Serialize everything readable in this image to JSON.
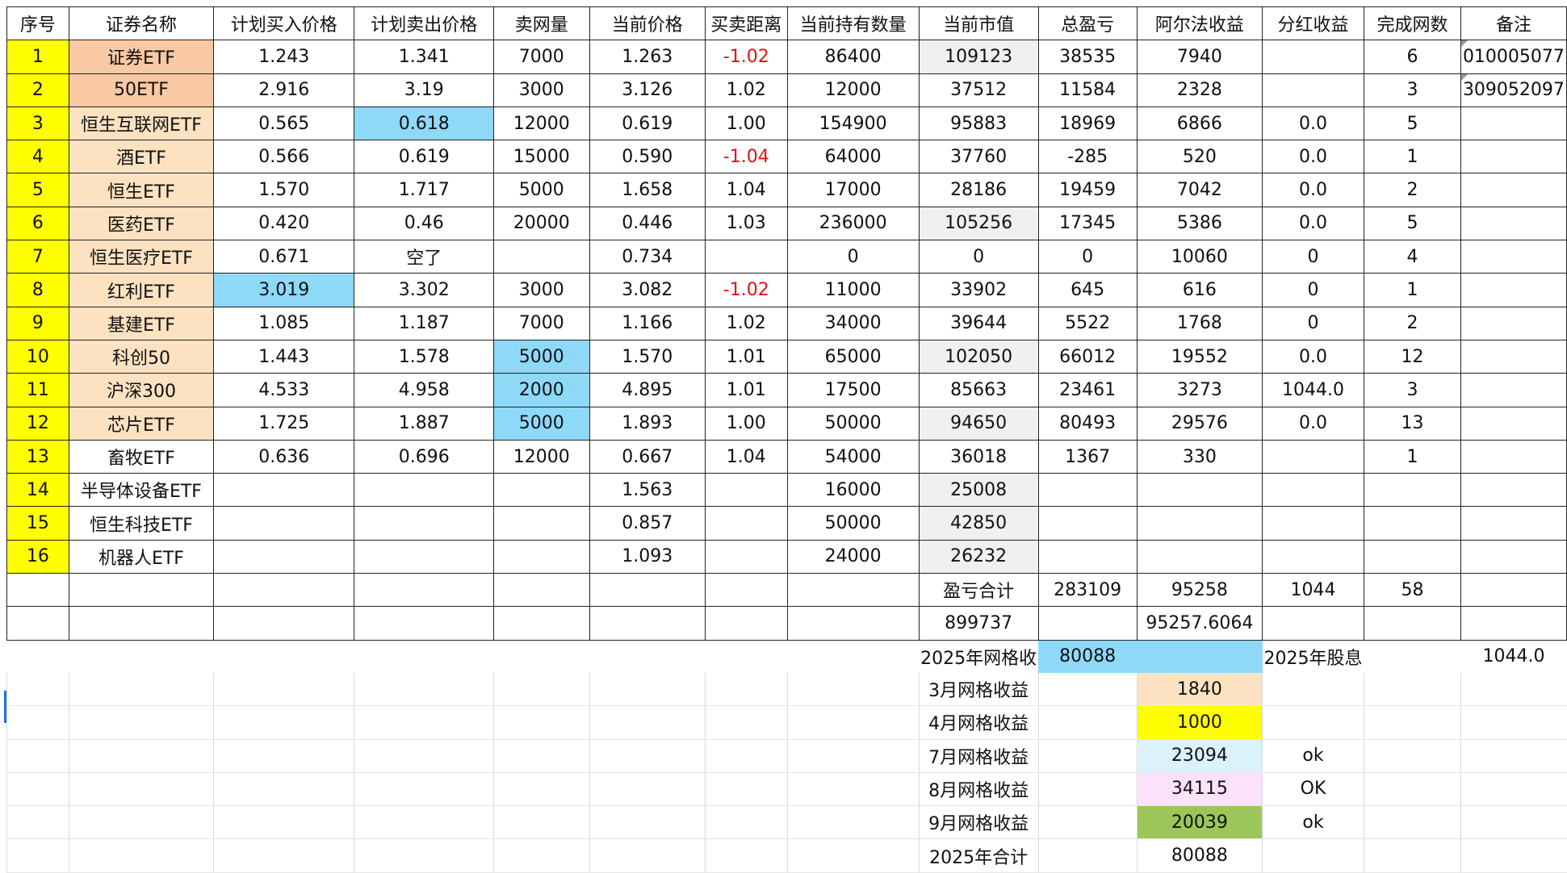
{
  "headers": [
    "序号",
    "证券名称",
    "计划买入价格",
    "计划卖出价格",
    "卖网量",
    "当前价格",
    "买卖距离",
    "当前持有数量",
    "当前市值",
    "总盈亏",
    "阿尔法收益",
    "分红收益",
    "完成网数",
    "备注"
  ],
  "rows": [
    [
      "1",
      "证券ETF",
      "1.243",
      "1.341",
      "7000",
      "1.263",
      "-1.02",
      "86400",
      "109123",
      "38535",
      "7940",
      "",
      "6",
      "010005077"
    ],
    [
      "2",
      "50ETF",
      "2.916",
      "3.19",
      "3000",
      "3.126",
      "1.02",
      "12000",
      "37512",
      "11584",
      "2328",
      "",
      "3",
      "309052097"
    ],
    [
      "3",
      "恒生互联网ETF",
      "0.565",
      "0.618",
      "12000",
      "0.619",
      "1.00",
      "154900",
      "95883",
      "18969",
      "6866",
      "0.0",
      "5",
      ""
    ],
    [
      "4",
      "酒ETF",
      "0.566",
      "0.619",
      "15000",
      "0.590",
      "-1.04",
      "64000",
      "37760",
      "-285",
      "520",
      "0.0",
      "1",
      ""
    ],
    [
      "5",
      "恒生ETF",
      "1.570",
      "1.717",
      "5000",
      "1.658",
      "1.04",
      "17000",
      "28186",
      "19459",
      "7042",
      "0.0",
      "2",
      ""
    ],
    [
      "6",
      "医药ETF",
      "0.420",
      "0.46",
      "20000",
      "0.446",
      "1.03",
      "236000",
      "105256",
      "17345",
      "5386",
      "0.0",
      "5",
      ""
    ],
    [
      "7",
      "恒生医疗ETF",
      "0.671",
      "空了",
      "",
      "0.734",
      "",
      "0",
      "0",
      "0",
      "10060",
      "0",
      "4",
      ""
    ],
    [
      "8",
      "红利ETF",
      "3.019",
      "3.302",
      "3000",
      "3.082",
      "-1.02",
      "11000",
      "33902",
      "645",
      "616",
      "0",
      "1",
      ""
    ],
    [
      "9",
      "基建ETF",
      "1.085",
      "1.187",
      "7000",
      "1.166",
      "1.02",
      "34000",
      "39644",
      "5522",
      "1768",
      "0",
      "2",
      ""
    ],
    [
      "10",
      "科创50",
      "1.443",
      "1.578",
      "5000",
      "1.570",
      "1.01",
      "65000",
      "102050",
      "66012",
      "19552",
      "0.0",
      "12",
      ""
    ],
    [
      "11",
      "沪深300",
      "4.533",
      "4.958",
      "2000",
      "4.895",
      "1.01",
      "17500",
      "85663",
      "23461",
      "3273",
      "1044.0",
      "3",
      ""
    ],
    [
      "12",
      "芯片ETF",
      "1.725",
      "1.887",
      "5000",
      "1.893",
      "1.00",
      "50000",
      "94650",
      "80493",
      "29576",
      "0.0",
      "13",
      ""
    ],
    [
      "13",
      "畜牧ETF",
      "0.636",
      "0.696",
      "12000",
      "0.667",
      "1.04",
      "54000",
      "36018",
      "1367",
      "330",
      "",
      "1",
      ""
    ],
    [
      "14",
      "半导体设备ETF",
      "",
      "",
      "",
      "1.563",
      "",
      "16000",
      "25008",
      "",
      "",
      "",
      "",
      ""
    ],
    [
      "15",
      "恒生科技ETF",
      "",
      "",
      "",
      "0.857",
      "",
      "50000",
      "42850",
      "",
      "",
      "",
      "",
      ""
    ],
    [
      "16",
      "机器人ETF",
      "",
      "",
      "",
      "1.093",
      "",
      "24000",
      "26232",
      "",
      "",
      "",
      "",
      ""
    ]
  ],
  "totals": {
    "label": "盈亏合计",
    "total_pnl": "283109",
    "total_alpha": "95258",
    "total_dividend": "1044",
    "total_grids": "58",
    "market_value_sum": "899737",
    "alpha_exact": "95257.6064"
  },
  "grid_summary": {
    "year_label": "2025年网格收",
    "year_value": "80088",
    "dividend_label": "2025年股息",
    "dividend_value": "1044.0",
    "months": [
      {
        "label": "3月网格收益",
        "value": "1840",
        "status": ""
      },
      {
        "label": "4月网格收益",
        "value": "1000",
        "status": ""
      },
      {
        "label": "7月网格收益",
        "value": "23094",
        "status": "ok"
      },
      {
        "label": "8月网格收益",
        "value": "34115",
        "status": "OK"
      },
      {
        "label": "9月网格收益",
        "value": "20039",
        "status": "ok"
      }
    ],
    "total_label": "2025年合计",
    "total_value": "80088"
  },
  "colors": {
    "index_fill": "#ffff00",
    "name_fill_peach": "#f9c9a3",
    "name_fill_orange": "#fde2c2",
    "highlight_blue": "#8ed8f8",
    "negative_text": "#e01010",
    "march_fill": "#fde2c2",
    "april_fill": "#ffff00",
    "july_fill": "#dbf2fb",
    "august_fill": "#fbe2fa",
    "september_fill": "#9cc65a"
  }
}
